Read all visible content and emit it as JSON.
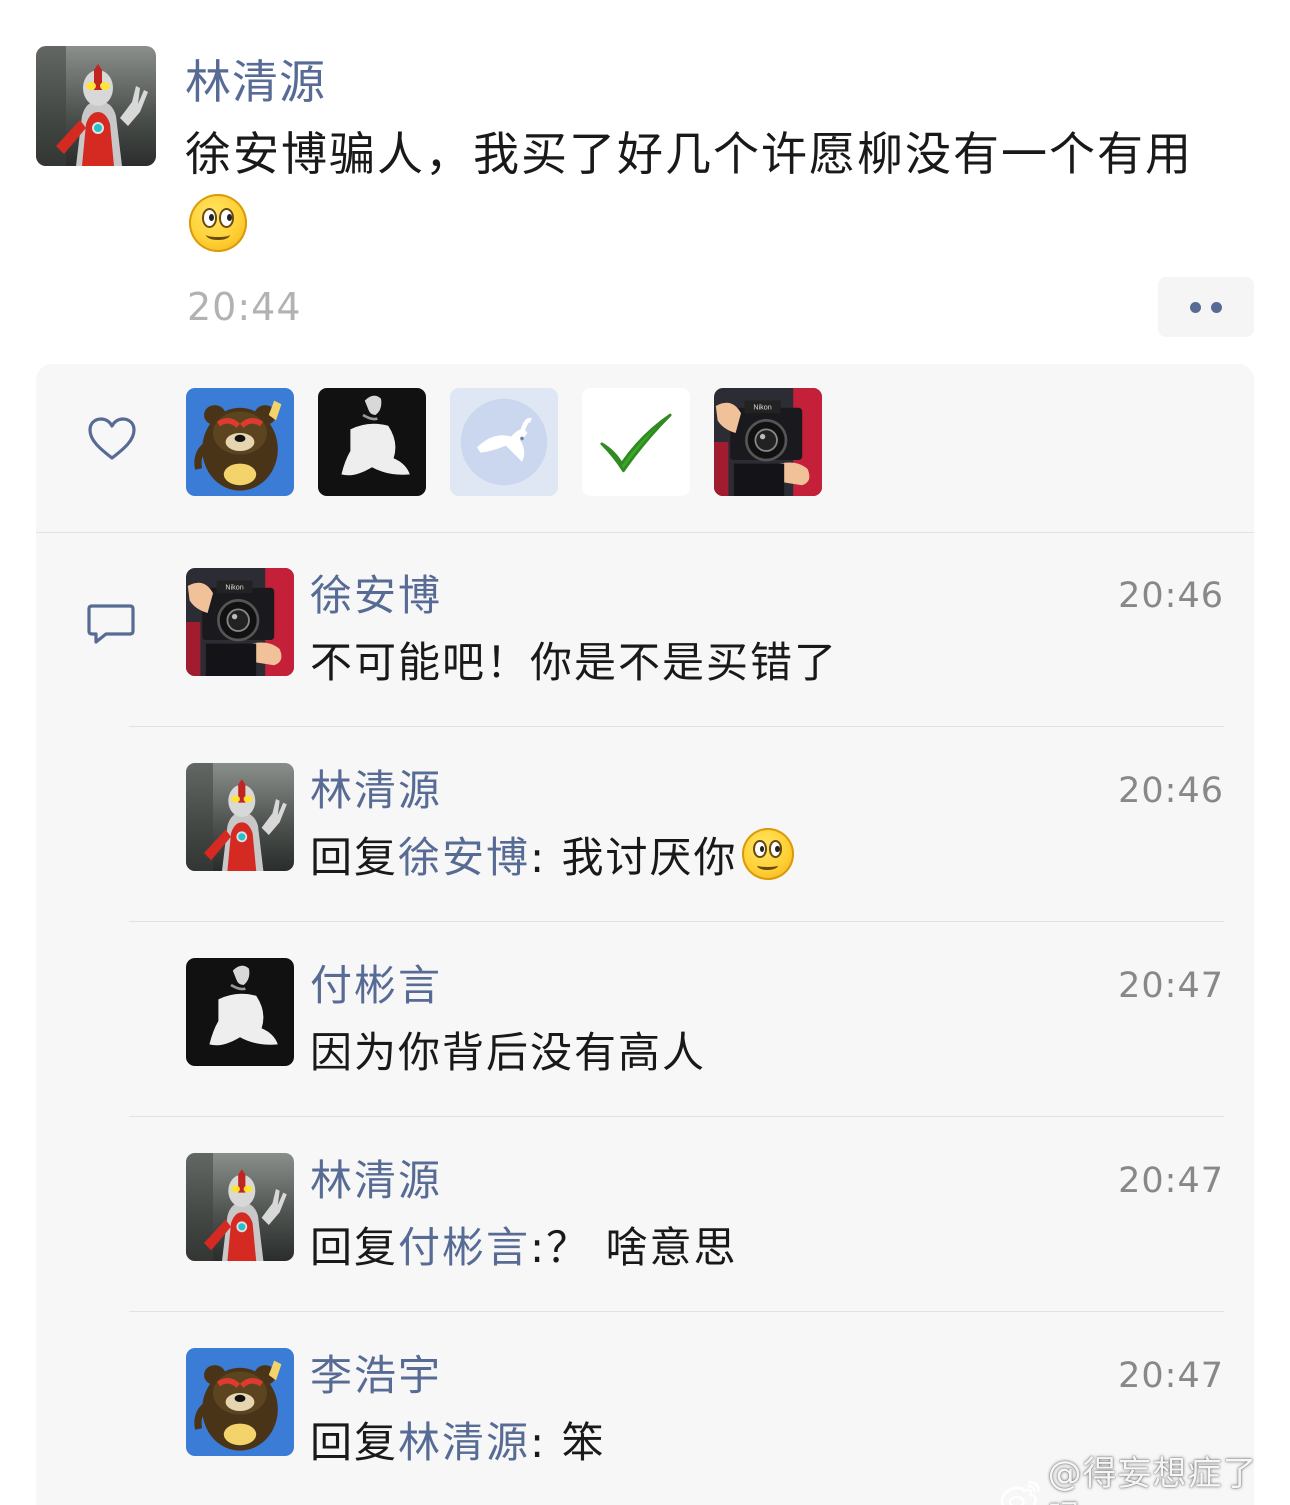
{
  "post": {
    "author": "林清源",
    "text": "徐安博骗人，我买了好几个许愿柳没有一个有用",
    "emoji": "smiling-face-emoji",
    "time": "20:44",
    "more_icon": "more-dots-icon"
  },
  "likes": {
    "icon": "heart-icon",
    "avatars": [
      "bear-avatar",
      "white-figure-avatar",
      "rabbit-avatar",
      "green-check-avatar",
      "camera-avatar"
    ]
  },
  "comments_icon": "comment-bubble-icon",
  "comments": [
    {
      "name": "徐安博",
      "time": "20:46",
      "reply_prefix": "",
      "reply_to": "",
      "text": "不可能吧！你是不是买错了",
      "emoji": ""
    },
    {
      "name": "林清源",
      "time": "20:46",
      "reply_prefix": "回复",
      "reply_to": "徐安博",
      "text": ": 我讨厌你",
      "emoji": "smiling-face-emoji"
    },
    {
      "name": "付彬言",
      "time": "20:47",
      "reply_prefix": "",
      "reply_to": "",
      "text": "因为你背后没有高人",
      "emoji": ""
    },
    {
      "name": "林清源",
      "time": "20:47",
      "reply_prefix": "回复",
      "reply_to": "付彬言",
      "text": ":？ 啥意思",
      "emoji": ""
    },
    {
      "name": "李浩宇",
      "time": "20:47",
      "reply_prefix": "回复",
      "reply_to": "林清源",
      "text": ": 笨",
      "emoji": ""
    }
  ],
  "watermark": {
    "icon": "weibo-logo-icon",
    "text": "@得妄想症了吗"
  },
  "colors": {
    "name_link": "#576b95",
    "body_text": "#191919",
    "time_text": "#b2b2b2",
    "panel_bg": "#f7f7f7"
  }
}
